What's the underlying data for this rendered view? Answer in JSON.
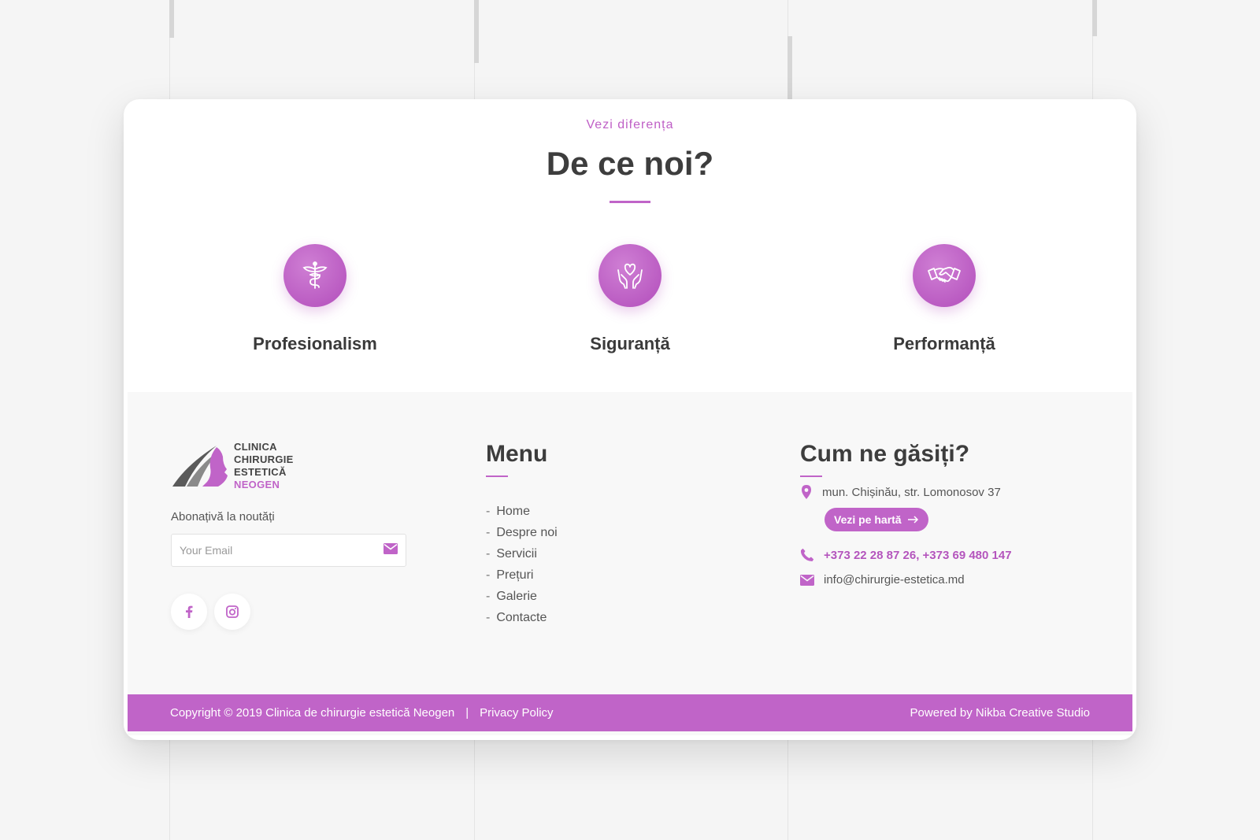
{
  "why": {
    "kicker": "Vezi diferența",
    "title": "De ce noi?",
    "features": [
      {
        "label": "Profesionalism",
        "icon": "caduceus-icon"
      },
      {
        "label": "Siguranță",
        "icon": "hands-heart-icon"
      },
      {
        "label": "Performanță",
        "icon": "handshake-icon"
      }
    ]
  },
  "footer": {
    "logo": {
      "line1": "CLINICA",
      "line2": "CHIRURGIE",
      "line3": "ESTETICĂ",
      "line4": "NEOGEN"
    },
    "subscribe_label": "Abonațivă la noutăți",
    "email_placeholder": "Your Email",
    "social": [
      "facebook-icon",
      "instagram-icon"
    ],
    "menu": {
      "title": "Menu",
      "items": [
        "Home",
        "Despre noi",
        "Servicii",
        "Prețuri",
        "Galerie",
        "Contacte"
      ]
    },
    "contact": {
      "title": "Cum ne găsiți?",
      "address": "mun. Chișinău, str. Lomonosov 37",
      "map_button": "Vezi pe hartă",
      "phones": "+373 22 28 87 26, +373 69 480 147",
      "email": "info@chirurgie-estetica.md"
    },
    "bottom": {
      "copyright": "Copyright © 2019 Clinica de chirurgie estetică Neogen",
      "separator": "|",
      "privacy": "Privacy Policy",
      "powered": "Powered by Nikba Creative Studio"
    }
  },
  "colors": {
    "accent": "#c064c8",
    "text": "#3d3d3d",
    "background": "#f5f5f5"
  }
}
